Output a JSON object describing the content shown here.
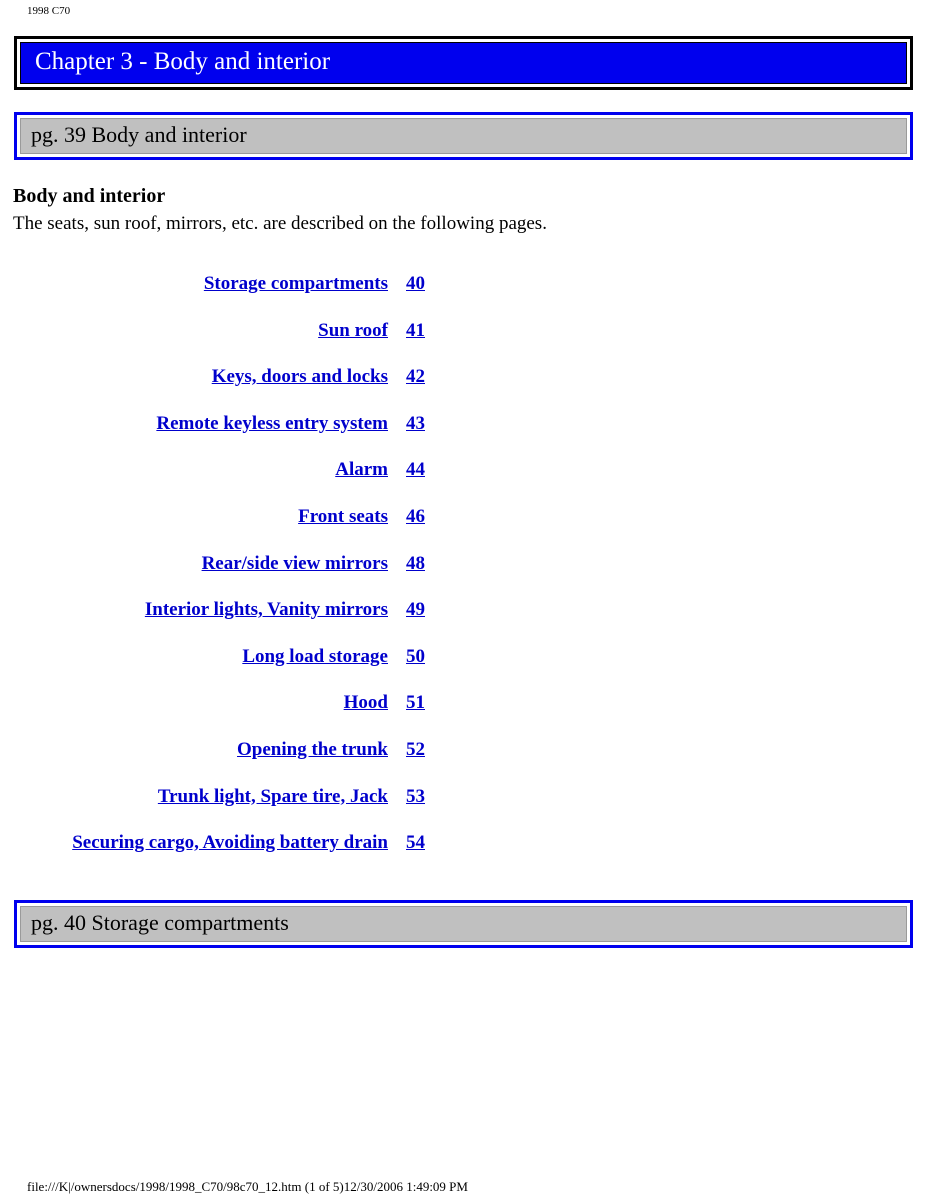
{
  "running_head": "1998 C70",
  "chapter": {
    "title": "Chapter 3 - Body and interior",
    "bar_bg_color": "#0000ee",
    "bar_border_color": "#000000",
    "text_color": "#ffffff"
  },
  "page_bar_top": {
    "label": "pg. 39 Body and interior",
    "bg_color": "#c0c0c0",
    "border_color": "#0000ee"
  },
  "page_bar_bottom": {
    "label": "pg. 40 Storage compartments",
    "bg_color": "#c0c0c0",
    "border_color": "#0000ee"
  },
  "section": {
    "heading": "Body and interior",
    "intro": "The seats, sun roof, mirrors, etc. are described on the following pages."
  },
  "toc": {
    "link_color": "#0000cc",
    "entries": [
      {
        "title": "Storage compartments",
        "page": "40"
      },
      {
        "title": "Sun roof",
        "page": "41"
      },
      {
        "title": "Keys, doors and locks",
        "page": "42"
      },
      {
        "title": "Remote keyless entry system",
        "page": "43"
      },
      {
        "title": "Alarm",
        "page": "44"
      },
      {
        "title": "Front seats",
        "page": "46"
      },
      {
        "title": "Rear/side view mirrors",
        "page": "48"
      },
      {
        "title": "Interior lights, Vanity mirrors",
        "page": "49"
      },
      {
        "title": "Long load storage",
        "page": "50"
      },
      {
        "title": "Hood",
        "page": "51"
      },
      {
        "title": "Opening the trunk",
        "page": "52"
      },
      {
        "title": "Trunk light, Spare tire, Jack",
        "page": "53"
      },
      {
        "title": "Securing cargo, Avoiding battery drain",
        "page": "54"
      }
    ]
  },
  "footer": {
    "path": "file:///K|/ownersdocs/1998/1998_C70/98c70_12.htm (1 of 5)12/30/2006 1:49:09 PM"
  }
}
